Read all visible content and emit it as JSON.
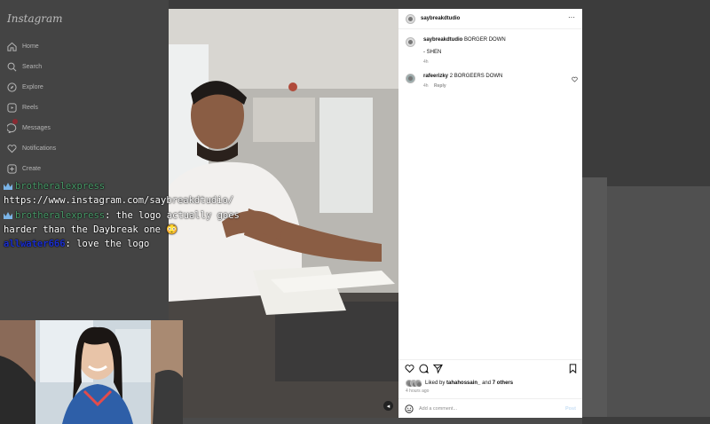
{
  "sidebar": {
    "logo": "Instagram",
    "items": [
      {
        "label": "Home",
        "icon": "home-icon"
      },
      {
        "label": "Search",
        "icon": "search-icon"
      },
      {
        "label": "Explore",
        "icon": "compass-icon"
      },
      {
        "label": "Reels",
        "icon": "reels-icon"
      },
      {
        "label": "Messages",
        "icon": "messenger-icon"
      },
      {
        "label": "Notifications",
        "icon": "heart-icon"
      },
      {
        "label": "Create",
        "icon": "plus-square-icon"
      }
    ]
  },
  "post": {
    "username": "saybreakdtudio",
    "more_icon": "more-icon",
    "caption_user": "saybreakdtudio",
    "caption_text": "BORGER DOWN",
    "caption_sign": "- SHEN",
    "caption_age": "4h",
    "comment": {
      "user": "rafeerizky",
      "text": "2 BORGEERS DOWN",
      "age": "4h",
      "reply_label": "Reply"
    },
    "liked_by_prefix": "Liked by",
    "liked_by_user": "tahahossain_",
    "liked_by_and": "and",
    "liked_by_others": "7 others",
    "timestamp": "4 hours ago",
    "comment_placeholder": "Add a comment...",
    "post_label": "Post"
  },
  "chat": [
    {
      "user": "brotheralexpress",
      "text": ""
    },
    {
      "user": "",
      "text": "https://www.instagram.com/saybreakdtudio/"
    },
    {
      "user": "brotheralexpress",
      "text": ": the logo actually goes"
    },
    {
      "user": "",
      "text": "harder than the Daybreak one 😳"
    },
    {
      "user": "allwater666",
      "text": ": love the logo"
    }
  ],
  "colors": {
    "accent_badge": "#8a2a32",
    "chat_green": "#4a9e6b",
    "chat_blue": "#1a2ecf",
    "crown": "#7ab4e8"
  }
}
